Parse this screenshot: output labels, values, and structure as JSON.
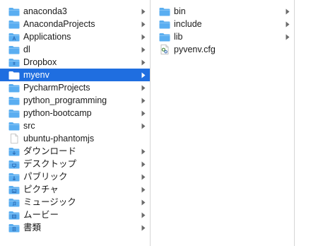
{
  "colors": {
    "selection": "#1f6ee0",
    "folder": "#5aaef0"
  },
  "columns": [
    {
      "items": [
        {
          "label": "anaconda3",
          "icon": "folder-icon",
          "chevron": true
        },
        {
          "label": "AnacondaProjects",
          "icon": "folder-icon",
          "chevron": true
        },
        {
          "label": "Applications",
          "icon": "applications-folder-icon",
          "chevron": true
        },
        {
          "label": "dl",
          "icon": "folder-icon",
          "chevron": true
        },
        {
          "label": "Dropbox",
          "icon": "dropbox-folder-icon",
          "chevron": true
        },
        {
          "label": "myenv",
          "icon": "folder-icon",
          "chevron": true,
          "selected": true
        },
        {
          "label": "PycharmProjects",
          "icon": "folder-icon",
          "chevron": true
        },
        {
          "label": "python_programming",
          "icon": "folder-icon",
          "chevron": true
        },
        {
          "label": "python-bootcamp",
          "icon": "folder-icon",
          "chevron": true
        },
        {
          "label": "src",
          "icon": "folder-icon",
          "chevron": true
        },
        {
          "label": "ubuntu-phantomjs",
          "icon": "document-icon",
          "chevron": false
        },
        {
          "label": "ダウンロード",
          "icon": "downloads-folder-icon",
          "chevron": true
        },
        {
          "label": "デスクトップ",
          "icon": "desktop-folder-icon",
          "chevron": true
        },
        {
          "label": "パブリック",
          "icon": "public-folder-icon",
          "chevron": true
        },
        {
          "label": "ピクチャ",
          "icon": "pictures-folder-icon",
          "chevron": true
        },
        {
          "label": "ミュージック",
          "icon": "music-folder-icon",
          "chevron": true
        },
        {
          "label": "ムービー",
          "icon": "movies-folder-icon",
          "chevron": true
        },
        {
          "label": "書類",
          "icon": "documents-folder-icon",
          "chevron": true
        }
      ]
    },
    {
      "items": [
        {
          "label": "bin",
          "icon": "folder-icon",
          "chevron": true
        },
        {
          "label": "include",
          "icon": "folder-icon",
          "chevron": true
        },
        {
          "label": "lib",
          "icon": "folder-icon",
          "chevron": true
        },
        {
          "label": "pyvenv.cfg",
          "icon": "config-file-icon",
          "chevron": false
        }
      ]
    },
    {
      "items": []
    }
  ]
}
